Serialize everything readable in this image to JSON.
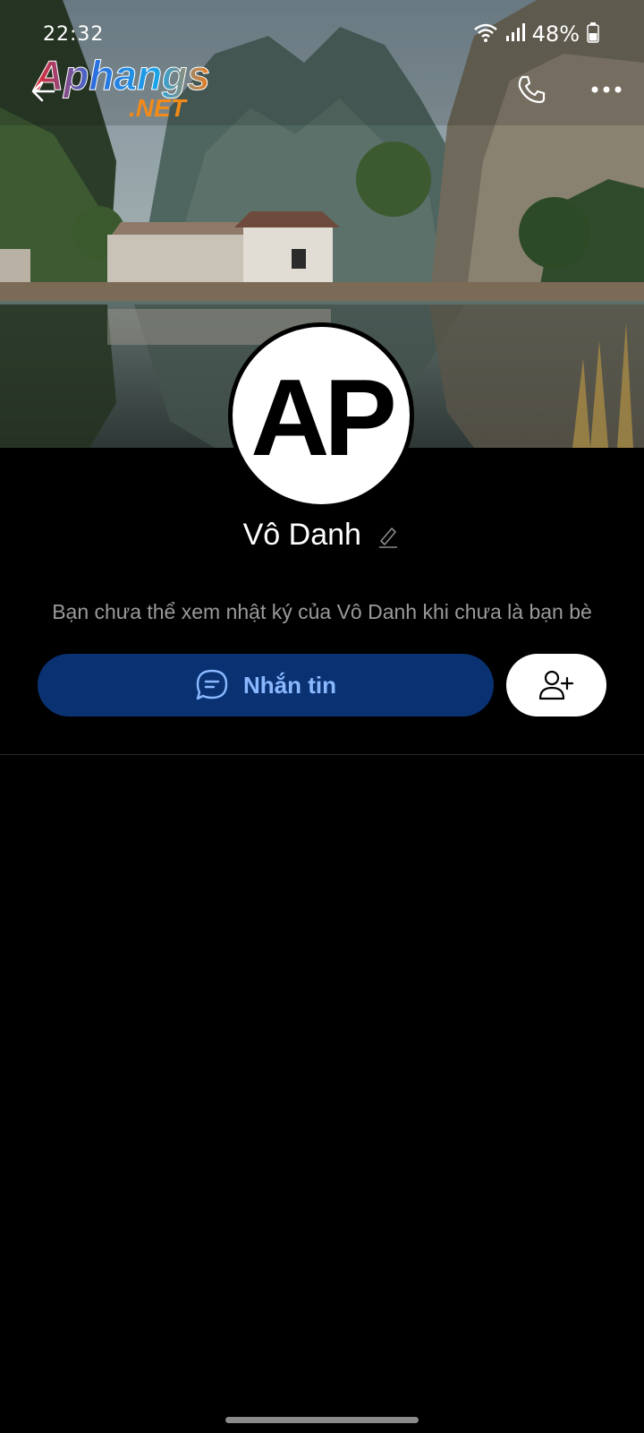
{
  "status_bar": {
    "time": "22:32",
    "battery": "48%"
  },
  "watermark": {
    "brand": "Aphangs",
    "suffix": ".NET"
  },
  "profile": {
    "avatar_text": "AP",
    "name": "Vô Danh",
    "notice": "Bạn chưa thể xem nhật ký của Vô Danh khi chưa là bạn bè"
  },
  "actions": {
    "message_label": "Nhắn tin"
  },
  "icons": {
    "back": "back-arrow-icon",
    "phone": "phone-icon",
    "more": "more-icon",
    "edit": "pencil-icon",
    "chat": "chat-bubble-icon",
    "add_friend": "add-user-icon"
  },
  "colors": {
    "message_button_bg": "#0a3273",
    "message_button_text": "#8ab8ff",
    "background": "#000000"
  }
}
